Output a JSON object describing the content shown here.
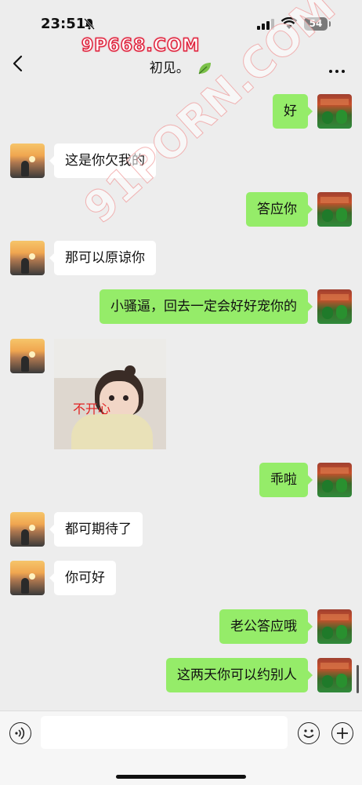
{
  "status_bar": {
    "time": "23:51",
    "battery": "54",
    "bell_icon": "bell-slash-icon",
    "signal_icon": "cellular-signal-icon",
    "wifi_icon": "wifi-icon"
  },
  "watermarks": {
    "top": "9P668.COM",
    "diagonal": "91PORN.COM"
  },
  "nav": {
    "title": "初见。",
    "back_icon": "chevron-left-icon",
    "leaf_icon": "leaf-icon",
    "more_icon": "more-dots-icon"
  },
  "messages": [
    {
      "side": "right",
      "text": "好"
    },
    {
      "side": "left",
      "text": "这是你欠我的"
    },
    {
      "side": "right",
      "text": "答应你"
    },
    {
      "side": "left",
      "text": "那可以原谅你"
    },
    {
      "side": "right",
      "text": "小骚逼，回去一定会好好宠你的"
    },
    {
      "side": "left",
      "type": "image",
      "caption": "不开心"
    },
    {
      "side": "right",
      "text": "乖啦"
    },
    {
      "side": "left",
      "text": "都可期待了"
    },
    {
      "side": "left",
      "text": "你可好"
    },
    {
      "side": "right",
      "text": "老公答应哦"
    },
    {
      "side": "right",
      "text": "这两天你可以约别人"
    }
  ],
  "input_bar": {
    "placeholder": "",
    "voice_icon": "voice-icon",
    "emoji_icon": "emoji-icon",
    "plus_icon": "plus-icon"
  },
  "colors": {
    "background": "#ededed",
    "sent_bubble": "#95ec69",
    "received_bubble": "#ffffff"
  }
}
